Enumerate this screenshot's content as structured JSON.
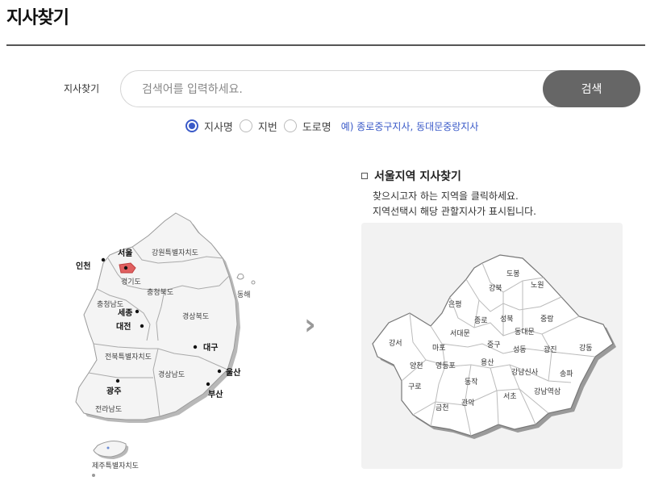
{
  "page": {
    "title": "지사찾기"
  },
  "search": {
    "label": "지사찾기",
    "placeholder": "검색어를 입력하세요.",
    "value": "",
    "button_label": "검색"
  },
  "search_options": [
    {
      "label": "지사명",
      "checked": true
    },
    {
      "label": "지번",
      "checked": false
    },
    {
      "label": "도로명",
      "checked": false
    }
  ],
  "search_example": "예) 종로중구지사, 동대문중랑지사",
  "korea_map": {
    "regions": {
      "gangwon": "강원특별자치도",
      "gyeonggi": "경기도",
      "chungbuk": "충청북도",
      "chungnam": "충청남도",
      "gyeongbuk": "경상북도",
      "jeonbuk": "전북특별자치도",
      "gyeongnam": "경상남도",
      "jeonnam": "전라남도",
      "jeju": "제주특별자치도",
      "ulleung": "동해"
    },
    "cities": {
      "seoul": "서울",
      "incheon": "인천",
      "sejong": "세종",
      "daejeon": "대전",
      "daegu": "대구",
      "ulsan": "울산",
      "busan": "부산",
      "gwangju": "광주"
    },
    "highlight_color": "#e06060"
  },
  "seoul_section": {
    "title": "서울지역 지사찾기",
    "guide_line1": "찾으시고자 하는 지역을 클릭하세요.",
    "guide_line2": "지역선택시 해당 관할지사가 표시됩니다.",
    "districts": {
      "dobong": "도봉",
      "nowon": "노원",
      "gangbuk": "강북",
      "eunpyeong": "은평",
      "seongbuk": "성북",
      "jongno": "종로",
      "jungnang": "중랑",
      "seodaemun": "서대문",
      "dongdaemun": "동대문",
      "gangseo": "강서",
      "mapo": "마포",
      "jung": "중구",
      "seongdong": "성동",
      "gwangjin": "광진",
      "gangdong": "강동",
      "yangcheon": "양천",
      "yeongdeungpo": "영등포",
      "yongsan": "용산",
      "gangnamsinsa": "강남신사",
      "songpa": "송파",
      "guro": "구로",
      "dongjak": "동작",
      "gangnamyeoksam": "강남역삼",
      "geumcheon": "금천",
      "gwanak": "관악",
      "seocho": "서초"
    }
  },
  "arrow_icon": "chevron-right-icon"
}
